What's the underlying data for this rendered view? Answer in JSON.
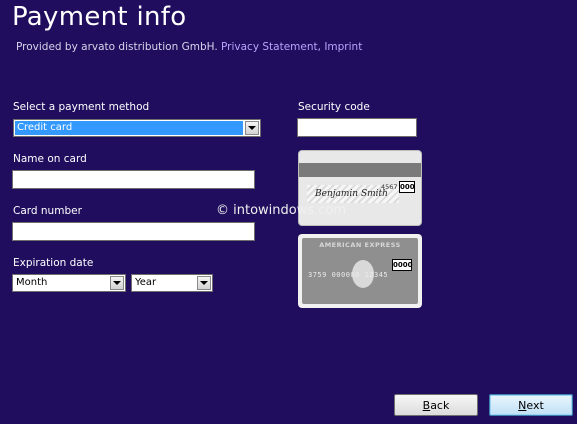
{
  "header": {
    "title": "Payment info",
    "provider_text": "Provided by arvato distribution GmbH.",
    "privacy_link": "Privacy Statement,",
    "imprint_link": "Imprint"
  },
  "form": {
    "payment_method_label": "Select a payment method",
    "payment_method_value": "Credit card",
    "name_label": "Name on card",
    "name_value": "",
    "card_number_label": "Card number",
    "card_number_value": "",
    "expiration_label": "Expiration date",
    "month_value": "Month",
    "year_value": "Year",
    "security_code_label": "Security code",
    "security_code_value": ""
  },
  "card_images": {
    "visa_sample_number": "4567",
    "visa_sample_cvv": "000",
    "visa_sample_signature": "Benjamin Smith",
    "amex_brand": "AMERICAN EXPRESS",
    "amex_sample_cid": "0000",
    "amex_sample_digits": "3759 000000 12345"
  },
  "watermark": "© intowindows.com",
  "buttons": {
    "back_accel": "B",
    "back_rest": "ack",
    "next_accel": "N",
    "next_rest": "ext"
  },
  "colors": {
    "background": "#200d5e",
    "link": "#b9a4ff",
    "selection": "#3399ff"
  }
}
